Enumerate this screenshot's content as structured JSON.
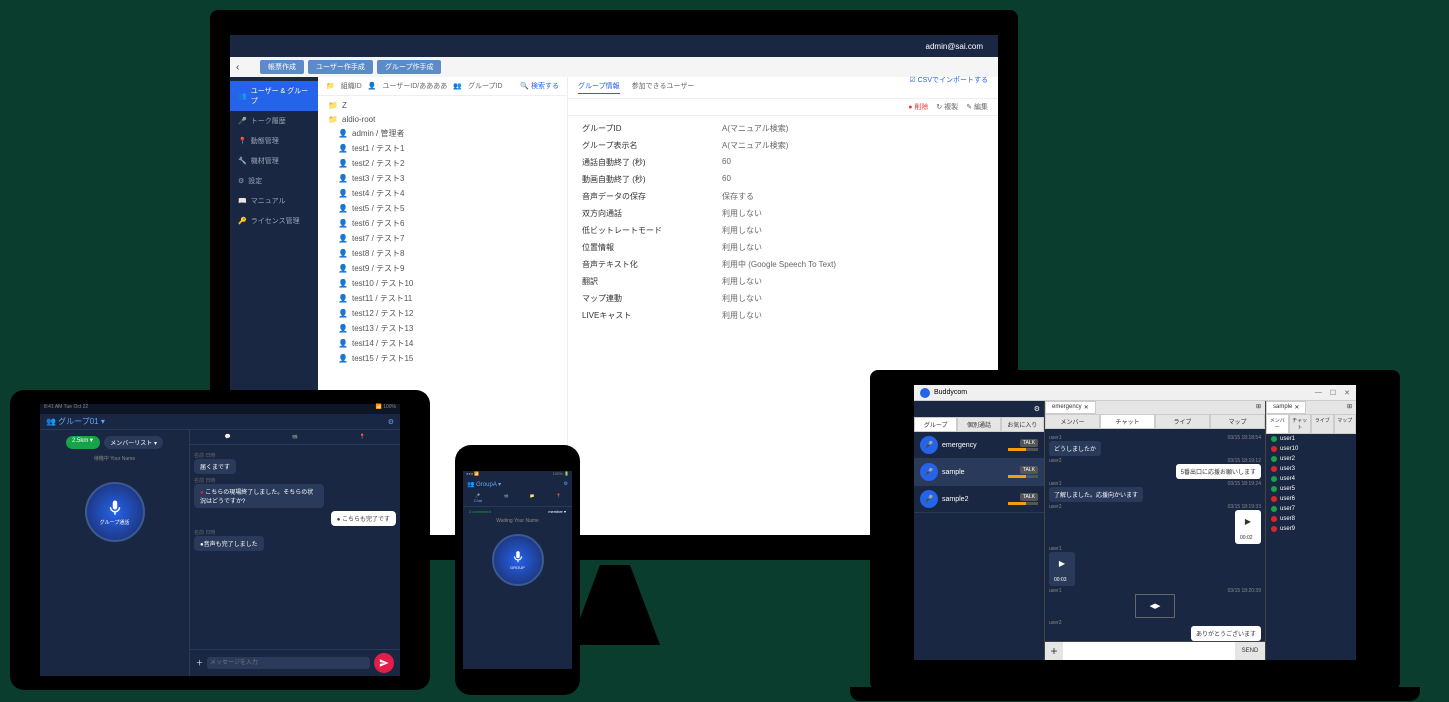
{
  "monitor": {
    "user": "admin@sai.com",
    "back_icon": "‹",
    "toolbar": {
      "btn1": "帳票作成",
      "btn2": "ユーザー作手成",
      "btn3": "グループ作手成"
    },
    "csv_link": "☑ CSVでインポートする",
    "sidebar": [
      {
        "label": "ユーザー & グループ",
        "active": true
      },
      {
        "label": "トーク履歴"
      },
      {
        "label": "動態管理"
      },
      {
        "label": "機材管理"
      },
      {
        "label": "設定"
      },
      {
        "label": "マニュアル"
      },
      {
        "label": "ライセンス管理"
      }
    ],
    "breadcrumb": {
      "org": "組織ID",
      "user": "ユーザーID/ああああ",
      "group": "グループID",
      "search": "検索する"
    },
    "tree": [
      {
        "type": "folder",
        "label": "Z"
      },
      {
        "type": "folder",
        "label": "aldio-root"
      },
      {
        "type": "user",
        "label": "admin / 管理者"
      },
      {
        "type": "user",
        "label": "test1 / テスト1"
      },
      {
        "type": "user",
        "label": "test2 / テスト2"
      },
      {
        "type": "user",
        "label": "test3 / テスト3"
      },
      {
        "type": "user",
        "label": "test4 / テスト4"
      },
      {
        "type": "user",
        "label": "test5 / テスト5"
      },
      {
        "type": "user",
        "label": "test6 / テスト6"
      },
      {
        "type": "user",
        "label": "test7 / テスト7"
      },
      {
        "type": "user",
        "label": "test8 / テスト8"
      },
      {
        "type": "user",
        "label": "test9 / テスト9"
      },
      {
        "type": "user",
        "label": "test10 / テスト10"
      },
      {
        "type": "user",
        "label": "test11 / テスト11"
      },
      {
        "type": "user",
        "label": "test12 / テスト12"
      },
      {
        "type": "user",
        "label": "test13 / テスト13"
      },
      {
        "type": "user",
        "label": "test14 / テスト14"
      },
      {
        "type": "user",
        "label": "test15 / テスト15"
      }
    ],
    "tabs": {
      "info": "グループ情報",
      "members": "参加できるユーザー"
    },
    "actions": {
      "del": "● 削除",
      "copy": "↻ 複製",
      "edit": "✎ 編集"
    },
    "details": [
      {
        "k": "グループID",
        "v": "A(マニュアル検索)"
      },
      {
        "k": "グループ表示名",
        "v": "A(マニュアル検索)"
      },
      {
        "k": "通話自動終了 (秒)",
        "v": "60"
      },
      {
        "k": "動画自動終了 (秒)",
        "v": "60"
      },
      {
        "k": "音声データの保存",
        "v": "保存する"
      },
      {
        "k": "双方向通話",
        "v": "利用しない"
      },
      {
        "k": "低ビットレートモード",
        "v": "利用しない"
      },
      {
        "k": "位置情報",
        "v": "利用しない"
      },
      {
        "k": "音声テキスト化",
        "v": "利用中 (Google Speech To Text)"
      },
      {
        "k": "翻訳",
        "v": "利用しない"
      },
      {
        "k": "マップ連動",
        "v": "利用しない"
      },
      {
        "k": "LIVEキャスト",
        "v": "利用しない"
      }
    ]
  },
  "tablet": {
    "status_left": "8:41 AM  Tue Oct 22",
    "status_right": "📶 100%",
    "title": "👥 グループ01 ▾",
    "pills": {
      "left": "2.5km▼",
      "right": "メンバーリスト ▾"
    },
    "sublabel": "待機中  Your Name",
    "mic_label": "グループ通話",
    "modes": {
      "chat": "💬",
      "video": "📹",
      "map": "📍"
    },
    "messages": [
      {
        "meta": "名前  日時",
        "text": "届くまです",
        "side": "left"
      },
      {
        "meta": "名前  日時",
        "text": "こちらの現場終了しました。そちらの状況はどうですか?",
        "side": "left",
        "dot": "red"
      },
      {
        "meta": "",
        "text": "● こちらも完了です",
        "side": "right",
        "white": true
      },
      {
        "meta": "名前  日時",
        "text": "●音声も完了しました",
        "side": "left"
      }
    ],
    "input_placeholder": "メッセージを入力"
  },
  "phone": {
    "status_left": "●●● 📶",
    "status_right": "100% 🔋",
    "title": "👥 GroupA ▾",
    "tabs": {
      "chat": "Chat",
      "video": "📹",
      "folder": "📁",
      "map": "📍"
    },
    "connected": "3 connected",
    "member": "member ▾",
    "waiting": "Waiting  Your Name",
    "mic_label": "GROUP"
  },
  "laptop": {
    "app": "Buddycom",
    "left_tabs": {
      "group": "グループ",
      "ind": "個別通話",
      "fav": "お気に入り"
    },
    "groups": [
      {
        "name": "emergency",
        "talk": "TALK",
        "sel": false
      },
      {
        "name": "sample",
        "talk": "TALK",
        "sel": true
      },
      {
        "name": "sample2",
        "talk": "TALK",
        "sel": false
      }
    ],
    "win_tabs": [
      {
        "label": "emergency",
        "close": "✕"
      },
      {
        "label": "sample",
        "close": "✕"
      }
    ],
    "mid_tabs": {
      "member": "メンバー",
      "chat": "チャット",
      "live": "ライブ",
      "map": "マップ"
    },
    "chat": [
      {
        "user": "user1",
        "time": "03/15 18:18:54",
        "text": "どうしましたか",
        "side": "left"
      },
      {
        "user": "user2",
        "time": "03/15 18:19:12",
        "text": "5番出口に応援お願いします",
        "side": "right",
        "white": true
      },
      {
        "user": "user1",
        "time": "03/15 18:19:24",
        "text": "了解しました。応援向かいます",
        "side": "left"
      },
      {
        "user": "user2",
        "time": "03/15 18:19:33",
        "type": "audio",
        "dur": "00:02",
        "side": "right",
        "white": true
      },
      {
        "user": "user1",
        "time": "",
        "type": "audio",
        "dur": "00:03",
        "side": "left"
      },
      {
        "user": "user1",
        "time": "03/15 18:20:39",
        "type": "video",
        "side": "left"
      },
      {
        "user": "user2",
        "time": "",
        "text": "ありがとうございます",
        "side": "right",
        "white": true
      }
    ],
    "send": "SEND",
    "right_tabs": {
      "member": "メンバー",
      "chat": "チャット",
      "live": "ライブ",
      "map": "マップ"
    },
    "members": [
      {
        "name": "user1",
        "status": "g"
      },
      {
        "name": "user10",
        "status": "r"
      },
      {
        "name": "user2",
        "status": "g"
      },
      {
        "name": "user3",
        "status": "r"
      },
      {
        "name": "user4",
        "status": "g"
      },
      {
        "name": "user5",
        "status": "g"
      },
      {
        "name": "user6",
        "status": "r"
      },
      {
        "name": "user7",
        "status": "g"
      },
      {
        "name": "user8",
        "status": "r"
      },
      {
        "name": "user9",
        "status": "r"
      }
    ]
  }
}
